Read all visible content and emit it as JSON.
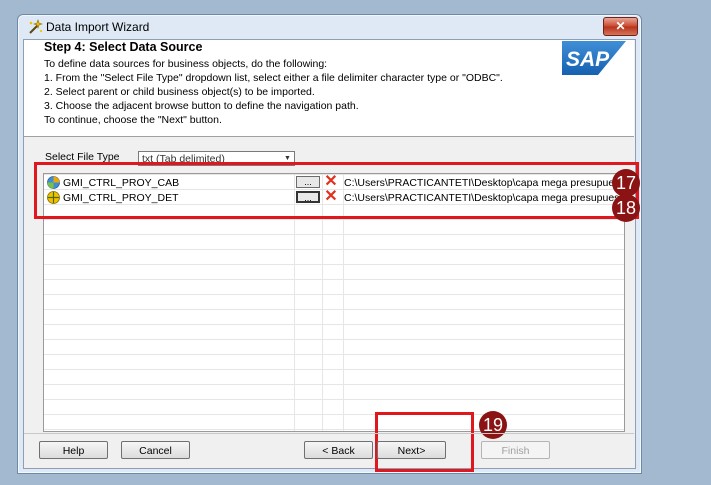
{
  "window": {
    "title": "Data Import Wizard",
    "close_glyph": "✕"
  },
  "header": {
    "step_title": "Step 4: Select Data Source",
    "instructions": [
      "To define data sources for business objects, do the following:",
      "1. From the \"Select File Type\" dropdown list, select either a file delimiter character type or \"ODBC\".",
      "2. Select parent or child business object(s) to be imported.",
      "3. Choose the adjacent browse button to define the navigation path.",
      "To continue, choose the \"Next\" button."
    ],
    "logo_text": "SAP"
  },
  "file_type": {
    "label": "Select File Type",
    "selected": "txt (Tab delimited)"
  },
  "rows": [
    {
      "name": "GMI_CTRL_PROY_CAB",
      "browse_label": "...",
      "path": "C:\\Users\\PRACTICANTETI\\Desktop\\capa mega presupuesto\\"
    },
    {
      "name": "GMI_CTRL_PROY_DET",
      "browse_label": "...",
      "path": "C:\\Users\\PRACTICANTETI\\Desktop\\capa mega presupuesto\\"
    }
  ],
  "callouts": [
    "17",
    "18",
    "19"
  ],
  "buttons": {
    "help": "Help",
    "cancel": "Cancel",
    "back": "< Back",
    "next": "Next>",
    "finish": "Finish"
  },
  "colors": {
    "highlight": "#e0171c",
    "callout": "#8b1313",
    "delete_icon": "#e0301e"
  }
}
